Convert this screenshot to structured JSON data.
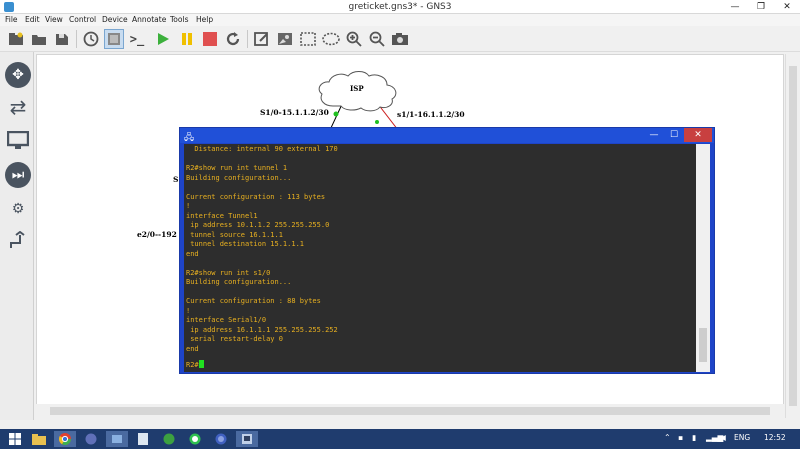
{
  "window": {
    "title": "greticket.gns3* - GNS3",
    "min_label": "—",
    "max_label": "❐",
    "close_label": "✕"
  },
  "menu": [
    "File",
    "Edit",
    "View",
    "Control",
    "Device",
    "Annotate",
    "Tools",
    "Help"
  ],
  "topology": {
    "cloud_label": "ISP",
    "links": [
      "S1/0-15.1.1.2/30",
      "s1/1-16.1.1.2/30",
      "S",
      "e2/0--192"
    ]
  },
  "console": {
    "lines": [
      "  Distance: internal 90 external 170",
      "",
      "R2#show run int tunnel 1",
      "Building configuration...",
      "",
      "Current configuration : 113 bytes",
      "!",
      "interface Tunnel1",
      " ip address 10.1.1.2 255.255.255.0",
      " tunnel source 16.1.1.1",
      " tunnel destination 15.1.1.1",
      "end",
      "",
      "R2#show run int s1/0",
      "Building configuration...",
      "",
      "Current configuration : 88 bytes",
      "!",
      "interface Serial1/0",
      " ip address 16.1.1.1 255.255.255.252",
      " serial restart-delay 0",
      "end",
      ""
    ],
    "prompt": "R2#",
    "min_label": "—",
    "max_label": "☐",
    "close_label": "✕"
  },
  "taskbar": {
    "language": "ENG",
    "time": "12:52"
  },
  "colors": {
    "console_frame": "#1e44c8",
    "console_bg": "#2d2d2d",
    "console_text": "#e8b020",
    "cursor": "#20e020",
    "taskbar": "#1f3c6e"
  }
}
